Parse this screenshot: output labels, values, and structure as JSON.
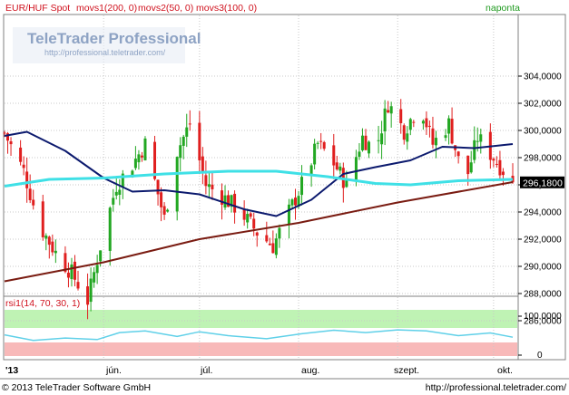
{
  "header": {
    "symbol": "EUR/HUF Spot",
    "indicators": [
      "movs1(200, 0)",
      "movs2(50, 0)",
      "movs3(100, 0)"
    ],
    "period": "naponta"
  },
  "watermark": {
    "brand": "TeleTrader Professional",
    "url": "http://professional.teletrader.com/"
  },
  "price_axis": {
    "ticks": [
      "304,0000",
      "302,0000",
      "300,0000",
      "298,0000",
      "296,0000",
      "294,0000",
      "292,0000",
      "290,0000",
      "288,0000",
      "286,0000"
    ],
    "last_price": "296,1800"
  },
  "rsi_panel": {
    "title": "rsi1(14, 70, 30, 1)",
    "ticks": [
      "100,0000",
      "0"
    ]
  },
  "time_axis": {
    "labels": [
      "'13",
      "jún.",
      "júl.",
      "aug.",
      "szept.",
      "okt."
    ]
  },
  "footer": {
    "copyright": "© 2013 TeleTrader Software GmbH",
    "url": "http://professional.teletrader.com/"
  },
  "colors": {
    "up": "#22a722",
    "down": "#e01f1f",
    "ma200": "#7a1c12",
    "ma50": "#0c1a6e",
    "ma100": "#3fe0e6",
    "rsi_line": "#5fd0e8",
    "rsi_overbought": "#bff3b4",
    "rsi_oversold": "#f8b9b9",
    "grid": "#c8c8c8",
    "header_text": "#d0121e",
    "period_text": "#1f9a1f"
  },
  "chart_data": [
    {
      "type": "candlestick",
      "title": "EUR/HUF Spot",
      "period": "naponta",
      "y_range": [
        284.5,
        305
      ],
      "x_range": [
        "2013-05-01",
        "2013-10-07"
      ],
      "x_ticks": [
        "'13",
        "jún.",
        "júl.",
        "aug.",
        "szept.",
        "okt."
      ],
      "last_close": 296.18,
      "anchors": [
        {
          "date": "2013-05-01",
          "close": 299.8
        },
        {
          "date": "2013-05-07",
          "close": 297.0
        },
        {
          "date": "2013-05-12",
          "close": 293.0
        },
        {
          "date": "2013-05-17",
          "close": 291.0
        },
        {
          "date": "2013-05-22",
          "close": 289.5
        },
        {
          "date": "2013-05-27",
          "close": 287.5
        },
        {
          "date": "2013-05-31",
          "close": 291.5
        },
        {
          "date": "2013-06-05",
          "close": 296.0
        },
        {
          "date": "2013-06-10",
          "close": 297.5
        },
        {
          "date": "2013-06-14",
          "close": 299.0
        },
        {
          "date": "2013-06-20",
          "close": 293.5
        },
        {
          "date": "2013-06-24",
          "close": 298.5
        },
        {
          "date": "2013-06-28",
          "close": 300.5
        },
        {
          "date": "2013-07-03",
          "close": 296.0
        },
        {
          "date": "2013-07-09",
          "close": 295.0
        },
        {
          "date": "2013-07-14",
          "close": 294.0
        },
        {
          "date": "2013-07-19",
          "close": 292.5
        },
        {
          "date": "2013-07-24",
          "close": 291.5
        },
        {
          "date": "2013-07-29",
          "close": 294.0
        },
        {
          "date": "2013-08-03",
          "close": 296.5
        },
        {
          "date": "2013-08-07",
          "close": 299.0
        },
        {
          "date": "2013-08-11",
          "close": 298.0
        },
        {
          "date": "2013-08-16",
          "close": 296.0
        },
        {
          "date": "2013-08-21",
          "close": 299.5
        },
        {
          "date": "2013-08-25",
          "close": 298.5
        },
        {
          "date": "2013-08-29",
          "close": 302.0
        },
        {
          "date": "2013-09-03",
          "close": 300.0
        },
        {
          "date": "2013-09-08",
          "close": 302.0
        },
        {
          "date": "2013-09-12",
          "close": 299.0
        },
        {
          "date": "2013-09-17",
          "close": 300.5
        },
        {
          "date": "2013-09-22",
          "close": 296.0
        },
        {
          "date": "2013-09-26",
          "close": 299.5
        },
        {
          "date": "2013-10-01",
          "close": 298.0
        },
        {
          "date": "2013-10-07",
          "close": 296.18
        }
      ],
      "series": [
        {
          "name": "movs1(200, 0)",
          "color": "#7a1c12",
          "points": [
            {
              "date": "2013-05-01",
              "y": 288.9
            },
            {
              "date": "2013-06-01",
              "y": 290.3
            },
            {
              "date": "2013-07-01",
              "y": 292.0
            },
            {
              "date": "2013-08-01",
              "y": 293.2
            },
            {
              "date": "2013-09-01",
              "y": 294.7
            },
            {
              "date": "2013-10-07",
              "y": 296.2
            }
          ]
        },
        {
          "name": "movs2(50, 0)",
          "color": "#0c1a6e",
          "points": [
            {
              "date": "2013-05-01",
              "y": 299.6
            },
            {
              "date": "2013-05-08",
              "y": 299.9
            },
            {
              "date": "2013-05-20",
              "y": 298.5
            },
            {
              "date": "2013-06-01",
              "y": 296.5
            },
            {
              "date": "2013-06-10",
              "y": 295.5
            },
            {
              "date": "2013-06-20",
              "y": 295.6
            },
            {
              "date": "2013-07-01",
              "y": 295.3
            },
            {
              "date": "2013-07-15",
              "y": 294.2
            },
            {
              "date": "2013-07-25",
              "y": 293.7
            },
            {
              "date": "2013-08-05",
              "y": 294.9
            },
            {
              "date": "2013-08-15",
              "y": 296.8
            },
            {
              "date": "2013-08-25",
              "y": 297.3
            },
            {
              "date": "2013-09-05",
              "y": 297.8
            },
            {
              "date": "2013-09-15",
              "y": 298.8
            },
            {
              "date": "2013-09-25",
              "y": 298.7
            },
            {
              "date": "2013-10-07",
              "y": 299.0
            }
          ]
        },
        {
          "name": "movs3(100, 0)",
          "color": "#3fe0e6",
          "points": [
            {
              "date": "2013-05-01",
              "y": 295.9
            },
            {
              "date": "2013-05-15",
              "y": 296.4
            },
            {
              "date": "2013-06-01",
              "y": 296.5
            },
            {
              "date": "2013-06-20",
              "y": 296.8
            },
            {
              "date": "2013-07-10",
              "y": 297.0
            },
            {
              "date": "2013-07-25",
              "y": 297.0
            },
            {
              "date": "2013-08-10",
              "y": 296.6
            },
            {
              "date": "2013-08-25",
              "y": 296.1
            },
            {
              "date": "2013-09-05",
              "y": 296.0
            },
            {
              "date": "2013-09-20",
              "y": 296.3
            },
            {
              "date": "2013-10-07",
              "y": 296.4
            }
          ]
        }
      ]
    },
    {
      "type": "line",
      "title": "rsi1(14, 70, 30, 1)",
      "y_range": [
        0,
        100
      ],
      "y_ticks": [
        100,
        0
      ],
      "bands": [
        {
          "from": 70,
          "to": 100,
          "color": "#bff3b4"
        },
        {
          "from": 0,
          "to": 30,
          "color": "#f8b9b9"
        }
      ],
      "series": [
        {
          "name": "rsi1(14, 70, 30, 1)",
          "color": "#5fd0e8",
          "points": [
            {
              "date": "2013-05-01",
              "y": 52
            },
            {
              "date": "2013-05-10",
              "y": 38
            },
            {
              "date": "2013-05-20",
              "y": 44
            },
            {
              "date": "2013-05-30",
              "y": 40
            },
            {
              "date": "2013-06-06",
              "y": 58
            },
            {
              "date": "2013-06-14",
              "y": 62
            },
            {
              "date": "2013-06-24",
              "y": 48
            },
            {
              "date": "2013-07-01",
              "y": 60
            },
            {
              "date": "2013-07-10",
              "y": 50
            },
            {
              "date": "2013-07-22",
              "y": 42
            },
            {
              "date": "2013-08-02",
              "y": 55
            },
            {
              "date": "2013-08-12",
              "y": 64
            },
            {
              "date": "2013-08-22",
              "y": 58
            },
            {
              "date": "2013-09-01",
              "y": 65
            },
            {
              "date": "2013-09-10",
              "y": 62
            },
            {
              "date": "2013-09-20",
              "y": 50
            },
            {
              "date": "2013-09-30",
              "y": 57
            },
            {
              "date": "2013-10-07",
              "y": 46
            }
          ]
        }
      ]
    }
  ]
}
